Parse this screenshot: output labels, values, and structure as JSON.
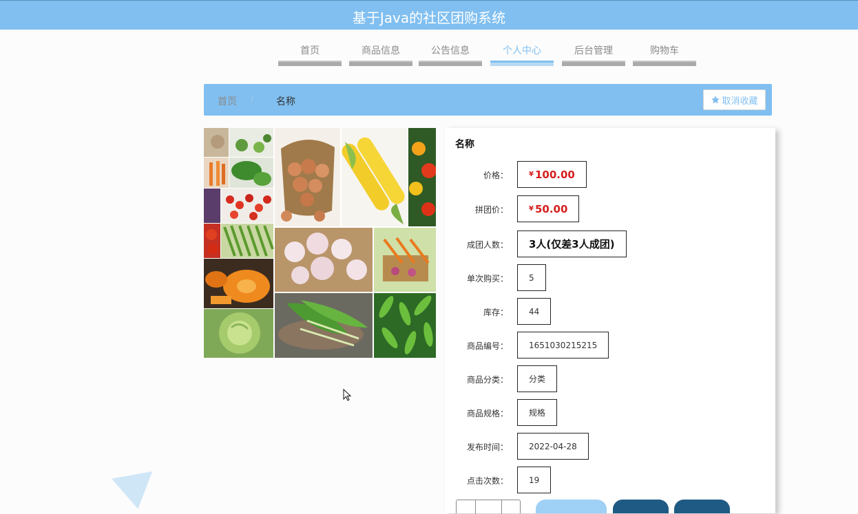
{
  "app": {
    "title": "基于Java的社区团购系统"
  },
  "nav": {
    "items": [
      {
        "label": "首页",
        "active": false
      },
      {
        "label": "商品信息",
        "active": false
      },
      {
        "label": "公告信息",
        "active": false
      },
      {
        "label": "个人中心",
        "active": true
      },
      {
        "label": "后台管理",
        "active": false
      },
      {
        "label": "购物车",
        "active": false
      }
    ]
  },
  "breadcrumb": {
    "home": "首页",
    "separator": "/",
    "current": "名称"
  },
  "favorite": {
    "label": "取消收藏",
    "icon": "star-icon"
  },
  "product": {
    "name": "名称",
    "currency": "¥",
    "fields": {
      "price_label": "价格：",
      "price": "100.00",
      "group_price_label": "拼团价：",
      "group_price": "50.00",
      "group_size_label": "成团人数：",
      "group_size": "3人(仅差3人成团)",
      "single_buy_label": "单次购买：",
      "single_buy": "5",
      "stock_label": "库存：",
      "stock": "44",
      "code_label": "商品编号：",
      "code": "1651030215215",
      "category_label": "商品分类：",
      "category": "分类",
      "spec_label": "商品规格：",
      "spec": "规格",
      "publish_time_label": "发布时间：",
      "publish_time": "2022-04-28",
      "clicks_label": "点击次数：",
      "clicks": "19"
    }
  },
  "colors": {
    "accent": "#80bff0",
    "price": "#d51f1f",
    "dark_button": "#1f5a84"
  }
}
